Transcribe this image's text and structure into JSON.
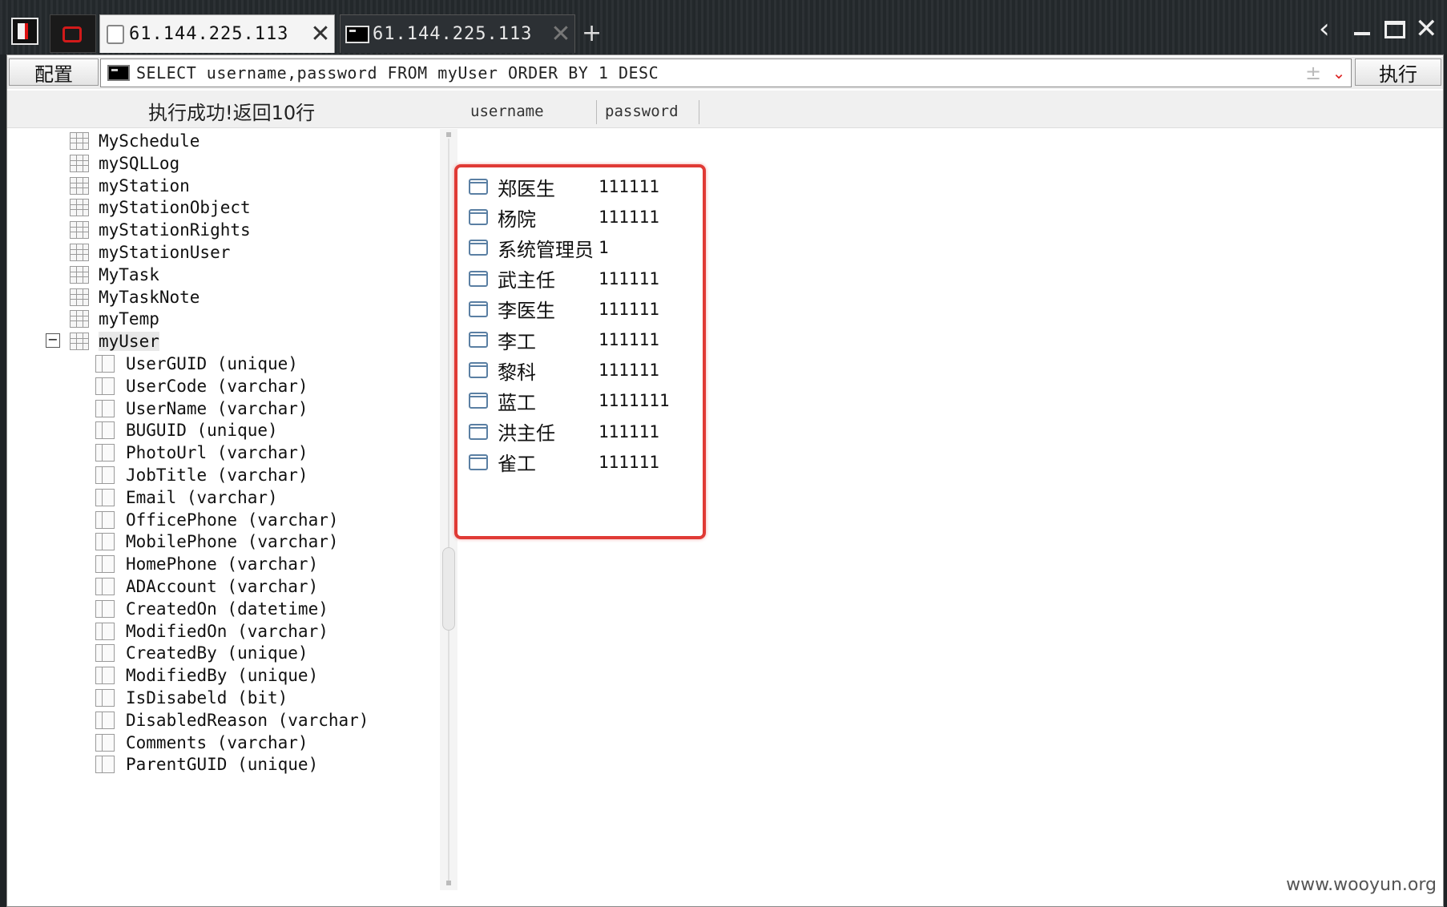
{
  "tabs": [
    {
      "label": "61.144.225.113"
    },
    {
      "label": "61.144.225.113"
    }
  ],
  "toolbar": {
    "config_label": "配置",
    "execute_label": "执行",
    "sql_query": "SELECT username,password FROM myUser ORDER BY 1 DESC",
    "plus_symbol": "±",
    "dropdown_symbol": "⌄"
  },
  "status": {
    "message": "执行成功!返回10行"
  },
  "result_columns": [
    "username",
    "password"
  ],
  "results": [
    {
      "username": "郑医生",
      "password": "111111"
    },
    {
      "username": "杨院",
      "password": "111111"
    },
    {
      "username": "系统管理员",
      "password": "1"
    },
    {
      "username": "武主任",
      "password": "111111"
    },
    {
      "username": "李医生",
      "password": "111111"
    },
    {
      "username": "李工",
      "password": "111111"
    },
    {
      "username": "黎科",
      "password": "111111"
    },
    {
      "username": "蓝工",
      "password": "1111111"
    },
    {
      "username": "洪主任",
      "password": "111111"
    },
    {
      "username": "雀工",
      "password": "111111"
    }
  ],
  "tree": {
    "tables": [
      "MySchedule",
      "mySQLLog",
      "myStation",
      "myStationObject",
      "myStationRights",
      "myStationUser",
      "MyTask",
      "MyTaskNote",
      "myTemp",
      "myUser"
    ],
    "expanded_table": "myUser",
    "expander_symbol": "−",
    "columns": [
      "UserGUID (unique)",
      "UserCode (varchar)",
      "UserName (varchar)",
      "BUGUID (unique)",
      "PhotoUrl (varchar)",
      "JobTitle (varchar)",
      "Email (varchar)",
      "OfficePhone (varchar)",
      "MobilePhone (varchar)",
      "HomePhone (varchar)",
      "ADAccount (varchar)",
      "CreatedOn (datetime)",
      "ModifiedOn (varchar)",
      "CreatedBy (unique)",
      "ModifiedBy (unique)",
      "IsDisabeld (bit)",
      "DisabledReason (varchar)",
      "Comments (varchar)",
      "ParentGUID (unique)"
    ]
  },
  "window_controls": {
    "back": "‹",
    "close": "✕",
    "new_tab": "+"
  },
  "watermark": "www.wooyun.org",
  "colors": {
    "highlight": "#e03a35",
    "error_red": "#d21a1a"
  }
}
